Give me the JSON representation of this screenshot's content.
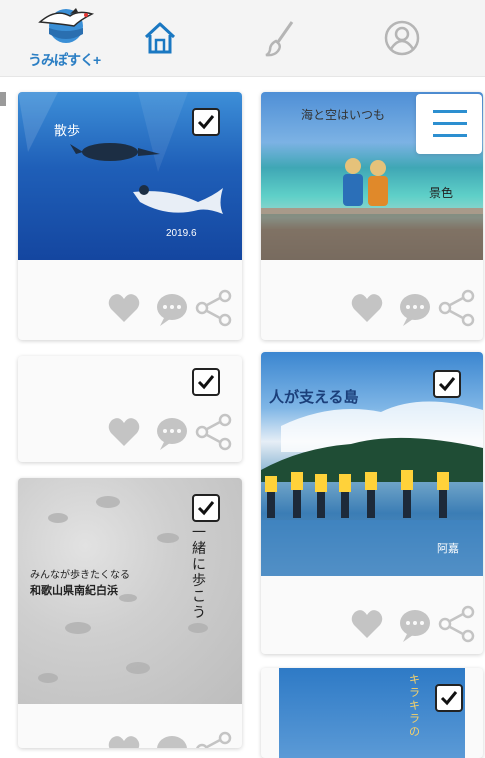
{
  "app": {
    "logo_text": "うみぽすく+",
    "brand_color": "#2c7fc4",
    "icon_color": "#1a78c2",
    "muted_icon_color": "#bdbdbd"
  },
  "nav": {
    "items": [
      {
        "name": "home",
        "icon": "home-icon"
      },
      {
        "name": "create",
        "icon": "brush-icon"
      },
      {
        "name": "profile",
        "icon": "profile-icon"
      }
    ],
    "menu_icon": "hamburger-menu-icon"
  },
  "posts": [
    {
      "id": "turtle",
      "checked": true,
      "caption_small": "散歩",
      "date": "2019.6"
    },
    {
      "id": "kids-sea",
      "checked": false,
      "caption_small": "海と空はいつも",
      "caption_right": "景色"
    },
    {
      "id": "empty",
      "checked": true
    },
    {
      "id": "island",
      "checked": true,
      "caption": "人が支える島",
      "place": "阿嘉"
    },
    {
      "id": "sand",
      "checked": true,
      "caption_left_1": "みんなが歩きたくなる",
      "caption_left_2": "和歌山県南紀白浜",
      "caption_vertical": "一緒に歩こう"
    },
    {
      "id": "sky",
      "checked": true,
      "caption_vertical": "キラキラの"
    }
  ]
}
